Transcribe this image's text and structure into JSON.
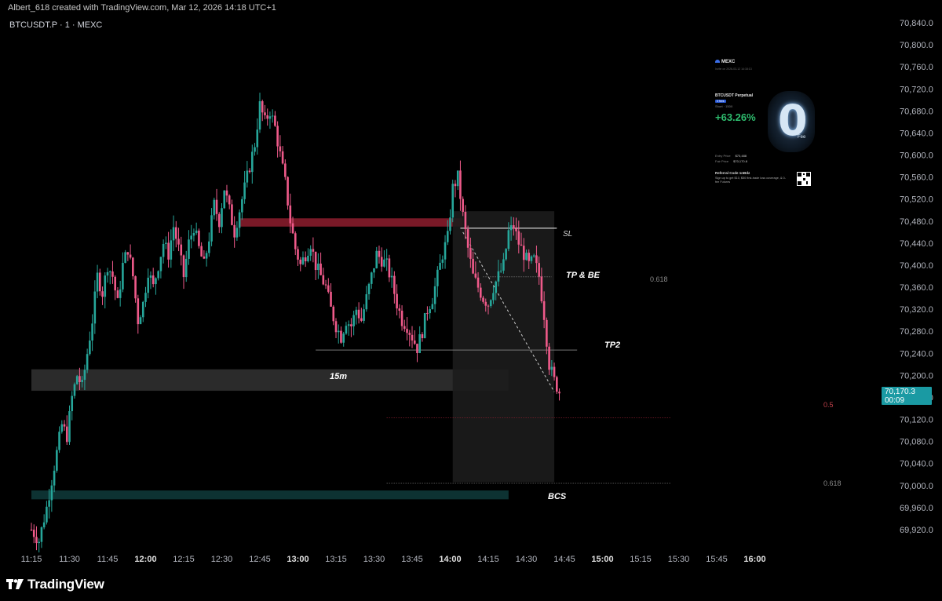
{
  "header": {
    "attribution": "Albert_618 created with TradingView.com, Mar 12, 2026 14:18 UTC+1"
  },
  "symbol": {
    "label": "BTCUSDT.P · 1 · MEXC"
  },
  "last_price": {
    "value": "70,170.3",
    "countdown": "00:09",
    "color": "#1a9aa3"
  },
  "footer": {
    "brand": "TradingView"
  },
  "colors": {
    "up": "#26a69a",
    "down": "#ef5a8a",
    "resistance": "#8e1d2e",
    "support": "#0f3b3b",
    "grid": "#111"
  },
  "annotations": {
    "sl": "SL",
    "tp_be": "TP & BE",
    "tp2": "TP2",
    "zone_15m": "15m",
    "bcs": "BCS",
    "fib_upper_0618": "0.618",
    "fib_lower_05": "0.5",
    "fib_lower_0618": "0.618"
  },
  "card": {
    "brand": "MEXC",
    "subtitle": "Invite on 2026-03-12 14:18:13",
    "pair": "BTCUSDT Perpetual",
    "badge": "0 fees",
    "side": "Short · 150X",
    "pnl": "+63.26%",
    "entry_label": "Entry Price",
    "entry_value": "$70,488",
    "fair_label": "Fair Price",
    "fair_value": "$70,170.8",
    "referral": "Referral Code  1nBdz",
    "promo": "Sign up to get $10, $50 first-trade loss coverage, & 0-fee Futures",
    "zero_glyph": "0",
    "zero_fee": "Fee"
  },
  "chart_data": {
    "type": "candlestick",
    "symbol": "BTCUSDT.P",
    "interval": "1",
    "exchange": "MEXC",
    "y_ticks": [
      70840,
      70800,
      70760,
      70720,
      70680,
      70640,
      70600,
      70560,
      70520,
      70480,
      70440,
      70400,
      70360,
      70320,
      70280,
      70240,
      70200,
      70160,
      70120,
      70080,
      70040,
      70000,
      69960,
      69920
    ],
    "y_tick_labels": [
      "70,840.0",
      "70,800.0",
      "70,760.0",
      "70,720.0",
      "70,680.0",
      "70,640.0",
      "70,600.0",
      "70,560.0",
      "70,520.0",
      "70,480.0",
      "70,440.0",
      "70,400.0",
      "70,360.0",
      "70,320.0",
      "70,280.0",
      "70,240.0",
      "70,200.0",
      "70,160.0",
      "70,120.0",
      "70,080.0",
      "70,040.0",
      "70,000.0",
      "69,960.0",
      "69,920.0"
    ],
    "ylim": [
      69890,
      70868
    ],
    "x_ticks": [
      {
        "label": "11:15",
        "bold": false
      },
      {
        "label": "11:30",
        "bold": false
      },
      {
        "label": "11:45",
        "bold": false
      },
      {
        "label": "12:00",
        "bold": true
      },
      {
        "label": "12:15",
        "bold": false
      },
      {
        "label": "12:30",
        "bold": false
      },
      {
        "label": "12:45",
        "bold": false
      },
      {
        "label": "13:00",
        "bold": true
      },
      {
        "label": "13:15",
        "bold": false
      },
      {
        "label": "13:30",
        "bold": false
      },
      {
        "label": "13:45",
        "bold": false
      },
      {
        "label": "14:00",
        "bold": true
      },
      {
        "label": "14:15",
        "bold": false
      },
      {
        "label": "14:30",
        "bold": false
      },
      {
        "label": "14:45",
        "bold": false
      },
      {
        "label": "15:00",
        "bold": true
      },
      {
        "label": "15:15",
        "bold": false
      },
      {
        "label": "15:30",
        "bold": false
      },
      {
        "label": "15:45",
        "bold": false
      },
      {
        "label": "16:00",
        "bold": true
      }
    ],
    "x_range_minutes": [
      0,
      300
    ],
    "first_candle_minute": 0,
    "close_path": [
      [
        0,
        69920
      ],
      [
        3,
        69900
      ],
      [
        6,
        69960
      ],
      [
        8,
        70010
      ],
      [
        10,
        70060
      ],
      [
        12,
        70110
      ],
      [
        14,
        70090
      ],
      [
        16,
        70160
      ],
      [
        18,
        70200
      ],
      [
        20,
        70180
      ],
      [
        22,
        70240
      ],
      [
        24,
        70300
      ],
      [
        26,
        70380
      ],
      [
        28,
        70350
      ],
      [
        30,
        70400
      ],
      [
        32,
        70380
      ],
      [
        34,
        70330
      ],
      [
        36,
        70400
      ],
      [
        38,
        70430
      ],
      [
        40,
        70380
      ],
      [
        42,
        70300
      ],
      [
        44,
        70330
      ],
      [
        46,
        70390
      ],
      [
        48,
        70360
      ],
      [
        50,
        70400
      ],
      [
        52,
        70440
      ],
      [
        54,
        70420
      ],
      [
        56,
        70470
      ],
      [
        58,
        70430
      ],
      [
        60,
        70380
      ],
      [
        62,
        70440
      ],
      [
        64,
        70470
      ],
      [
        66,
        70430
      ],
      [
        68,
        70400
      ],
      [
        70,
        70450
      ],
      [
        72,
        70510
      ],
      [
        74,
        70480
      ],
      [
        76,
        70540
      ],
      [
        78,
        70500
      ],
      [
        80,
        70460
      ],
      [
        82,
        70500
      ],
      [
        84,
        70540
      ],
      [
        86,
        70580
      ],
      [
        88,
        70620
      ],
      [
        90,
        70690
      ],
      [
        92,
        70660
      ],
      [
        94,
        70680
      ],
      [
        96,
        70650
      ],
      [
        98,
        70600
      ],
      [
        100,
        70550
      ],
      [
        102,
        70480
      ],
      [
        104,
        70430
      ],
      [
        106,
        70400
      ],
      [
        108,
        70420
      ],
      [
        110,
        70440
      ],
      [
        112,
        70400
      ],
      [
        114,
        70380
      ],
      [
        116,
        70360
      ],
      [
        118,
        70320
      ],
      [
        120,
        70290
      ],
      [
        122,
        70270
      ],
      [
        124,
        70300
      ],
      [
        126,
        70290
      ],
      [
        128,
        70320
      ],
      [
        130,
        70300
      ],
      [
        132,
        70340
      ],
      [
        134,
        70380
      ],
      [
        136,
        70420
      ],
      [
        138,
        70410
      ],
      [
        140,
        70400
      ],
      [
        142,
        70370
      ],
      [
        144,
        70330
      ],
      [
        146,
        70300
      ],
      [
        148,
        70290
      ],
      [
        150,
        70270
      ],
      [
        152,
        70250
      ],
      [
        154,
        70280
      ],
      [
        156,
        70320
      ],
      [
        158,
        70340
      ],
      [
        160,
        70380
      ],
      [
        162,
        70420
      ],
      [
        164,
        70450
      ],
      [
        166,
        70540
      ],
      [
        168,
        70560
      ],
      [
        170,
        70490
      ],
      [
        172,
        70430
      ],
      [
        174,
        70380
      ],
      [
        176,
        70360
      ],
      [
        178,
        70340
      ],
      [
        180,
        70330
      ],
      [
        182,
        70360
      ],
      [
        184,
        70380
      ],
      [
        186,
        70400
      ],
      [
        188,
        70460
      ],
      [
        190,
        70470
      ],
      [
        192,
        70440
      ],
      [
        194,
        70420
      ],
      [
        196,
        70400
      ],
      [
        198,
        70410
      ],
      [
        200,
        70380
      ],
      [
        202,
        70310
      ],
      [
        204,
        70220
      ],
      [
        206,
        70190
      ],
      [
        208,
        70170
      ]
    ],
    "y_axis_scale": "linear",
    "grid": false,
    "levels": [
      {
        "name": "SL",
        "price": 70467,
        "from_min": 169,
        "to_min": 207,
        "color": "#ffffff"
      },
      {
        "name": "TP & BE",
        "price": 70379,
        "from_min": 178,
        "to_min": 205,
        "color": "#888888"
      },
      {
        "name": "TP2",
        "price": 70246,
        "from_min": 112,
        "to_min": 215,
        "color": "#777777"
      },
      {
        "name": "fib 0.5",
        "price": 70123,
        "from_min": 140,
        "to_min": 252,
        "color": "#8e2030"
      },
      {
        "name": "fib 0.618",
        "price": 70004,
        "from_min": 140,
        "to_min": 252,
        "color": "#777777"
      }
    ],
    "zones": [
      {
        "name": "resistance",
        "top": 70485,
        "bottom": 70470,
        "from_min": 82,
        "to_min": 170,
        "color": "#8e1d2e"
      },
      {
        "name": "15m",
        "top": 70211,
        "bottom": 70172,
        "from_min": 0,
        "to_min": 188,
        "color": "#3a3a3a"
      },
      {
        "name": "BCS",
        "top": 69991,
        "bottom": 69975,
        "from_min": 0,
        "to_min": 188,
        "color": "#0f3b3b"
      },
      {
        "name": "trade box",
        "top": 70498,
        "bottom": 70006,
        "from_min": 166,
        "to_min": 206,
        "color": "#1c1c1c"
      }
    ]
  }
}
